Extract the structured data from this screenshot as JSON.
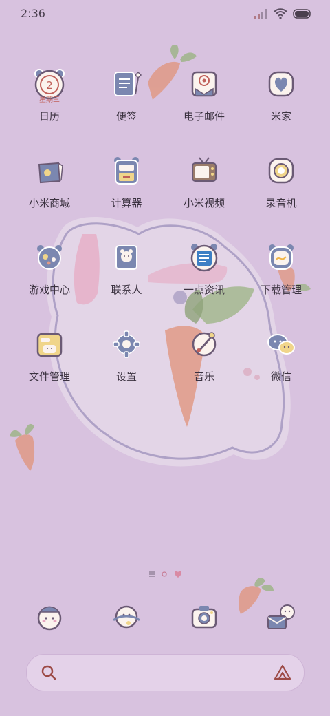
{
  "status_bar": {
    "time": "2:36",
    "icons": [
      "signal-icon",
      "wifi-icon",
      "battery-icon"
    ]
  },
  "calendar": {
    "day": "2",
    "weekday": "星期三"
  },
  "apps": [
    {
      "label": "日历",
      "icon": "calendar-icon"
    },
    {
      "label": "便签",
      "icon": "notes-icon"
    },
    {
      "label": "电子邮件",
      "icon": "email-icon"
    },
    {
      "label": "米家",
      "icon": "mijia-heart-icon"
    },
    {
      "label": "小米商城",
      "icon": "store-bag-icon"
    },
    {
      "label": "计算器",
      "icon": "calculator-icon"
    },
    {
      "label": "小米视频",
      "icon": "tv-icon"
    },
    {
      "label": "录音机",
      "icon": "recorder-icon"
    },
    {
      "label": "游戏中心",
      "icon": "gamepad-icon"
    },
    {
      "label": "联系人",
      "icon": "contacts-icon"
    },
    {
      "label": "一点资讯",
      "icon": "news-icon"
    },
    {
      "label": "下载管理",
      "icon": "download-icon"
    },
    {
      "label": "文件管理",
      "icon": "folder-icon"
    },
    {
      "label": "设置",
      "icon": "settings-gear-icon"
    },
    {
      "label": "音乐",
      "icon": "music-note-icon"
    },
    {
      "label": "微信",
      "icon": "wechat-icon"
    }
  ],
  "dock": [
    {
      "icon": "phone-bear-icon"
    },
    {
      "icon": "messages-planet-icon"
    },
    {
      "icon": "camera-icon"
    },
    {
      "icon": "gallery-envelope-icon"
    }
  ],
  "search": {
    "icon": "search-icon",
    "assistant_icon": "assistant-triangle-icon"
  },
  "colors": {
    "background": "#d8c2df",
    "icon_outline": "#6b5a75",
    "label": "#3b3240"
  }
}
